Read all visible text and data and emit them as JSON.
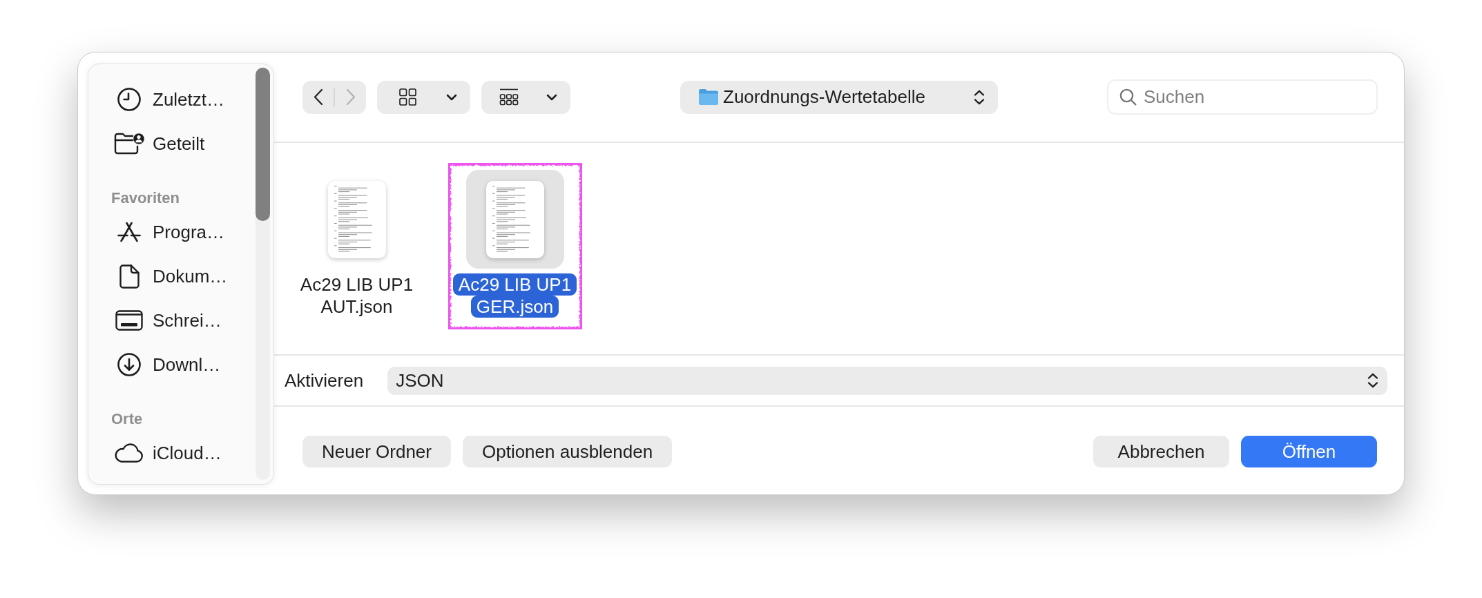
{
  "sidebar": {
    "sections": [
      {
        "items": [
          {
            "label": "Zuletzt…",
            "selected": false
          },
          {
            "label": "Geteilt",
            "selected": false
          }
        ]
      },
      {
        "title": "Favoriten",
        "items": [
          {
            "label": "Progra…",
            "selected": false
          },
          {
            "label": "Dokum…",
            "selected": false
          },
          {
            "label": "Schrei…",
            "selected": false
          },
          {
            "label": "Downl…",
            "selected": false
          }
        ]
      },
      {
        "title": "Orte",
        "items": [
          {
            "label": "iCloud…",
            "selected": false
          }
        ]
      }
    ]
  },
  "toolbar": {
    "navigation": [
      {
        "kind": "back",
        "disabled": false
      },
      {
        "kind": "forward",
        "disabled": true
      }
    ],
    "location": "Zuordnungs-Wertetabelle",
    "search": {
      "placeholder": "Suchen"
    }
  },
  "files": [
    {
      "name": "Ac29 LIB UP1 AUT.json",
      "selected": false,
      "highlighted": false
    },
    {
      "name": "Ac29 LIB UP1 GER.json",
      "selected": true,
      "highlighted": true
    }
  ],
  "filter": {
    "label": "Aktivieren",
    "value": "JSON"
  },
  "buttons_left": [
    {
      "label": "Neuer Ordner",
      "kind": "default"
    },
    {
      "label": "Optionen ausblenden",
      "kind": "default"
    }
  ],
  "buttons_right": [
    {
      "label": "Abbrechen",
      "kind": "default"
    },
    {
      "label": "Öffnen",
      "kind": "primary"
    }
  ]
}
